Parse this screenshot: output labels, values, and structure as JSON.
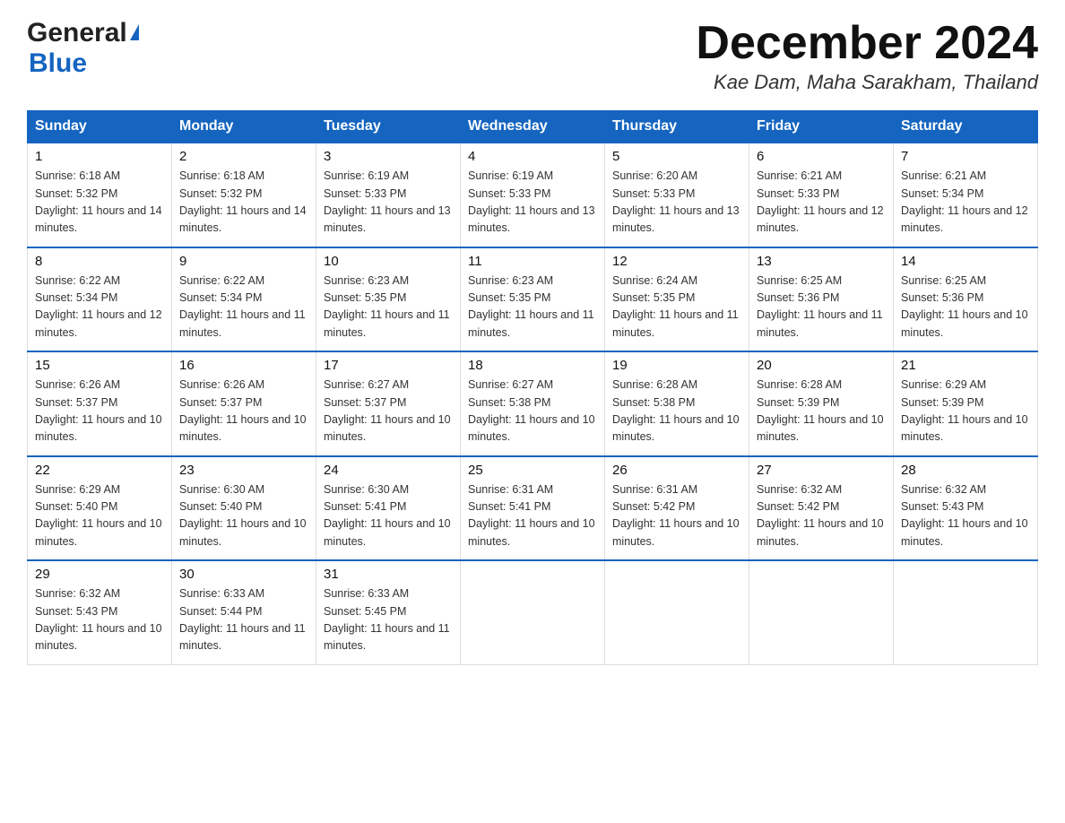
{
  "header": {
    "logo_general": "General",
    "logo_blue": "Blue",
    "month_title": "December 2024",
    "location": "Kae Dam, Maha Sarakham, Thailand"
  },
  "weekdays": [
    "Sunday",
    "Monday",
    "Tuesday",
    "Wednesday",
    "Thursday",
    "Friday",
    "Saturday"
  ],
  "weeks": [
    [
      {
        "day": "1",
        "sunrise": "6:18 AM",
        "sunset": "5:32 PM",
        "daylight": "11 hours and 14 minutes."
      },
      {
        "day": "2",
        "sunrise": "6:18 AM",
        "sunset": "5:32 PM",
        "daylight": "11 hours and 14 minutes."
      },
      {
        "day": "3",
        "sunrise": "6:19 AM",
        "sunset": "5:33 PM",
        "daylight": "11 hours and 13 minutes."
      },
      {
        "day": "4",
        "sunrise": "6:19 AM",
        "sunset": "5:33 PM",
        "daylight": "11 hours and 13 minutes."
      },
      {
        "day": "5",
        "sunrise": "6:20 AM",
        "sunset": "5:33 PM",
        "daylight": "11 hours and 13 minutes."
      },
      {
        "day": "6",
        "sunrise": "6:21 AM",
        "sunset": "5:33 PM",
        "daylight": "11 hours and 12 minutes."
      },
      {
        "day": "7",
        "sunrise": "6:21 AM",
        "sunset": "5:34 PM",
        "daylight": "11 hours and 12 minutes."
      }
    ],
    [
      {
        "day": "8",
        "sunrise": "6:22 AM",
        "sunset": "5:34 PM",
        "daylight": "11 hours and 12 minutes."
      },
      {
        "day": "9",
        "sunrise": "6:22 AM",
        "sunset": "5:34 PM",
        "daylight": "11 hours and 11 minutes."
      },
      {
        "day": "10",
        "sunrise": "6:23 AM",
        "sunset": "5:35 PM",
        "daylight": "11 hours and 11 minutes."
      },
      {
        "day": "11",
        "sunrise": "6:23 AM",
        "sunset": "5:35 PM",
        "daylight": "11 hours and 11 minutes."
      },
      {
        "day": "12",
        "sunrise": "6:24 AM",
        "sunset": "5:35 PM",
        "daylight": "11 hours and 11 minutes."
      },
      {
        "day": "13",
        "sunrise": "6:25 AM",
        "sunset": "5:36 PM",
        "daylight": "11 hours and 11 minutes."
      },
      {
        "day": "14",
        "sunrise": "6:25 AM",
        "sunset": "5:36 PM",
        "daylight": "11 hours and 10 minutes."
      }
    ],
    [
      {
        "day": "15",
        "sunrise": "6:26 AM",
        "sunset": "5:37 PM",
        "daylight": "11 hours and 10 minutes."
      },
      {
        "day": "16",
        "sunrise": "6:26 AM",
        "sunset": "5:37 PM",
        "daylight": "11 hours and 10 minutes."
      },
      {
        "day": "17",
        "sunrise": "6:27 AM",
        "sunset": "5:37 PM",
        "daylight": "11 hours and 10 minutes."
      },
      {
        "day": "18",
        "sunrise": "6:27 AM",
        "sunset": "5:38 PM",
        "daylight": "11 hours and 10 minutes."
      },
      {
        "day": "19",
        "sunrise": "6:28 AM",
        "sunset": "5:38 PM",
        "daylight": "11 hours and 10 minutes."
      },
      {
        "day": "20",
        "sunrise": "6:28 AM",
        "sunset": "5:39 PM",
        "daylight": "11 hours and 10 minutes."
      },
      {
        "day": "21",
        "sunrise": "6:29 AM",
        "sunset": "5:39 PM",
        "daylight": "11 hours and 10 minutes."
      }
    ],
    [
      {
        "day": "22",
        "sunrise": "6:29 AM",
        "sunset": "5:40 PM",
        "daylight": "11 hours and 10 minutes."
      },
      {
        "day": "23",
        "sunrise": "6:30 AM",
        "sunset": "5:40 PM",
        "daylight": "11 hours and 10 minutes."
      },
      {
        "day": "24",
        "sunrise": "6:30 AM",
        "sunset": "5:41 PM",
        "daylight": "11 hours and 10 minutes."
      },
      {
        "day": "25",
        "sunrise": "6:31 AM",
        "sunset": "5:41 PM",
        "daylight": "11 hours and 10 minutes."
      },
      {
        "day": "26",
        "sunrise": "6:31 AM",
        "sunset": "5:42 PM",
        "daylight": "11 hours and 10 minutes."
      },
      {
        "day": "27",
        "sunrise": "6:32 AM",
        "sunset": "5:42 PM",
        "daylight": "11 hours and 10 minutes."
      },
      {
        "day": "28",
        "sunrise": "6:32 AM",
        "sunset": "5:43 PM",
        "daylight": "11 hours and 10 minutes."
      }
    ],
    [
      {
        "day": "29",
        "sunrise": "6:32 AM",
        "sunset": "5:43 PM",
        "daylight": "11 hours and 10 minutes."
      },
      {
        "day": "30",
        "sunrise": "6:33 AM",
        "sunset": "5:44 PM",
        "daylight": "11 hours and 11 minutes."
      },
      {
        "day": "31",
        "sunrise": "6:33 AM",
        "sunset": "5:45 PM",
        "daylight": "11 hours and 11 minutes."
      },
      null,
      null,
      null,
      null
    ]
  ],
  "labels": {
    "sunrise": "Sunrise:",
    "sunset": "Sunset:",
    "daylight": "Daylight:"
  }
}
